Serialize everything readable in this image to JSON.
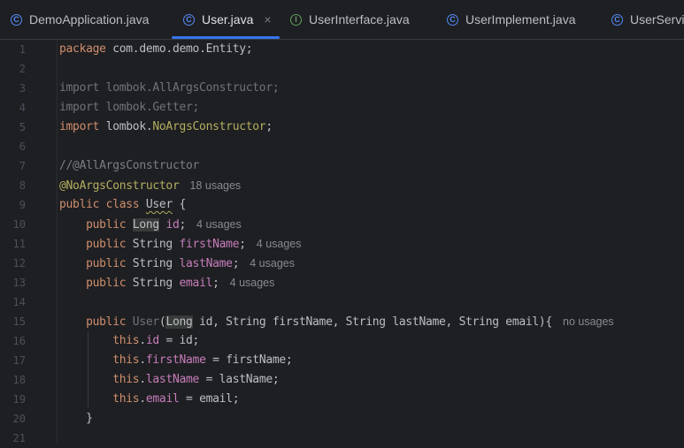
{
  "tabs": [
    {
      "label": "DemoApplication.java",
      "icon": "class-icon",
      "active": false
    },
    {
      "label": "User.java",
      "icon": "class-icon",
      "active": true
    },
    {
      "label": "UserInterface.java",
      "icon": "interface-icon",
      "active": false
    },
    {
      "label": "UserImplement.java",
      "icon": "class-icon",
      "active": false
    },
    {
      "label": "UserServi",
      "icon": "class-icon",
      "active": false
    }
  ],
  "lines": [
    {
      "n": "1",
      "tokens": [
        [
          "package ",
          "kw"
        ],
        [
          "com.demo.demo.Entity;",
          "txt"
        ]
      ]
    },
    {
      "n": "2",
      "tokens": []
    },
    {
      "n": "3",
      "tokens": [
        [
          "import lombok.AllArgsConstructor;",
          "unused"
        ]
      ]
    },
    {
      "n": "4",
      "tokens": [
        [
          "import lombok.Getter;",
          "unused"
        ]
      ]
    },
    {
      "n": "5",
      "tokens": [
        [
          "import ",
          "kw"
        ],
        [
          "lombok.",
          "txt"
        ],
        [
          "NoArgsConstructor",
          "ann"
        ],
        [
          ";",
          "txt"
        ]
      ]
    },
    {
      "n": "6",
      "tokens": []
    },
    {
      "n": "7",
      "tokens": [
        [
          "//@AllArgsConstructor",
          "cmt"
        ]
      ]
    },
    {
      "n": "8",
      "tokens": [
        [
          "@NoArgsConstructor",
          "ann"
        ]
      ],
      "hint": "18 usages"
    },
    {
      "n": "9",
      "tokens": [
        [
          "public class ",
          "kw"
        ],
        [
          "User",
          "cls warn"
        ],
        [
          " {",
          "txt"
        ]
      ]
    },
    {
      "n": "10",
      "tokens": [
        [
          "    public ",
          "kw"
        ],
        [
          "Long",
          "txt hl"
        ],
        [
          " ",
          "txt"
        ],
        [
          "id",
          "fld"
        ],
        [
          ";",
          "txt"
        ]
      ],
      "hint": "4 usages"
    },
    {
      "n": "11",
      "tokens": [
        [
          "    public ",
          "kw"
        ],
        [
          "String ",
          "txt"
        ],
        [
          "firstName",
          "fld"
        ],
        [
          ";",
          "txt"
        ]
      ],
      "hint": "4 usages"
    },
    {
      "n": "12",
      "tokens": [
        [
          "    public ",
          "kw"
        ],
        [
          "String ",
          "txt"
        ],
        [
          "lastName",
          "fld"
        ],
        [
          ";",
          "txt"
        ]
      ],
      "hint": "4 usages"
    },
    {
      "n": "13",
      "tokens": [
        [
          "    public ",
          "kw"
        ],
        [
          "String ",
          "txt"
        ],
        [
          "email",
          "fld"
        ],
        [
          ";",
          "txt"
        ]
      ],
      "hint": "4 usages"
    },
    {
      "n": "14",
      "tokens": []
    },
    {
      "n": "15",
      "tokens": [
        [
          "    public ",
          "kw"
        ],
        [
          "User",
          "ctor"
        ],
        [
          "(",
          "txt"
        ],
        [
          "Long",
          "txt hl"
        ],
        [
          " id, String firstName, String lastName, String email){",
          "txt"
        ]
      ],
      "hint": "no usages"
    },
    {
      "n": "16",
      "tokens": [
        [
          "        this",
          "kw"
        ],
        [
          ".",
          "txt"
        ],
        [
          "id",
          "fld"
        ],
        [
          " = id;",
          "txt"
        ]
      ]
    },
    {
      "n": "17",
      "tokens": [
        [
          "        this",
          "kw"
        ],
        [
          ".",
          "txt"
        ],
        [
          "firstName",
          "fld"
        ],
        [
          " = firstName;",
          "txt"
        ]
      ]
    },
    {
      "n": "18",
      "tokens": [
        [
          "        this",
          "kw"
        ],
        [
          ".",
          "txt"
        ],
        [
          "lastName",
          "fld"
        ],
        [
          " = lastName;",
          "txt"
        ]
      ]
    },
    {
      "n": "19",
      "tokens": [
        [
          "        this",
          "kw"
        ],
        [
          ".",
          "txt"
        ],
        [
          "email",
          "fld"
        ],
        [
          " = email;",
          "txt"
        ]
      ]
    },
    {
      "n": "20",
      "tokens": [
        [
          "    }",
          "txt"
        ]
      ]
    },
    {
      "n": "21",
      "tokens": []
    }
  ]
}
